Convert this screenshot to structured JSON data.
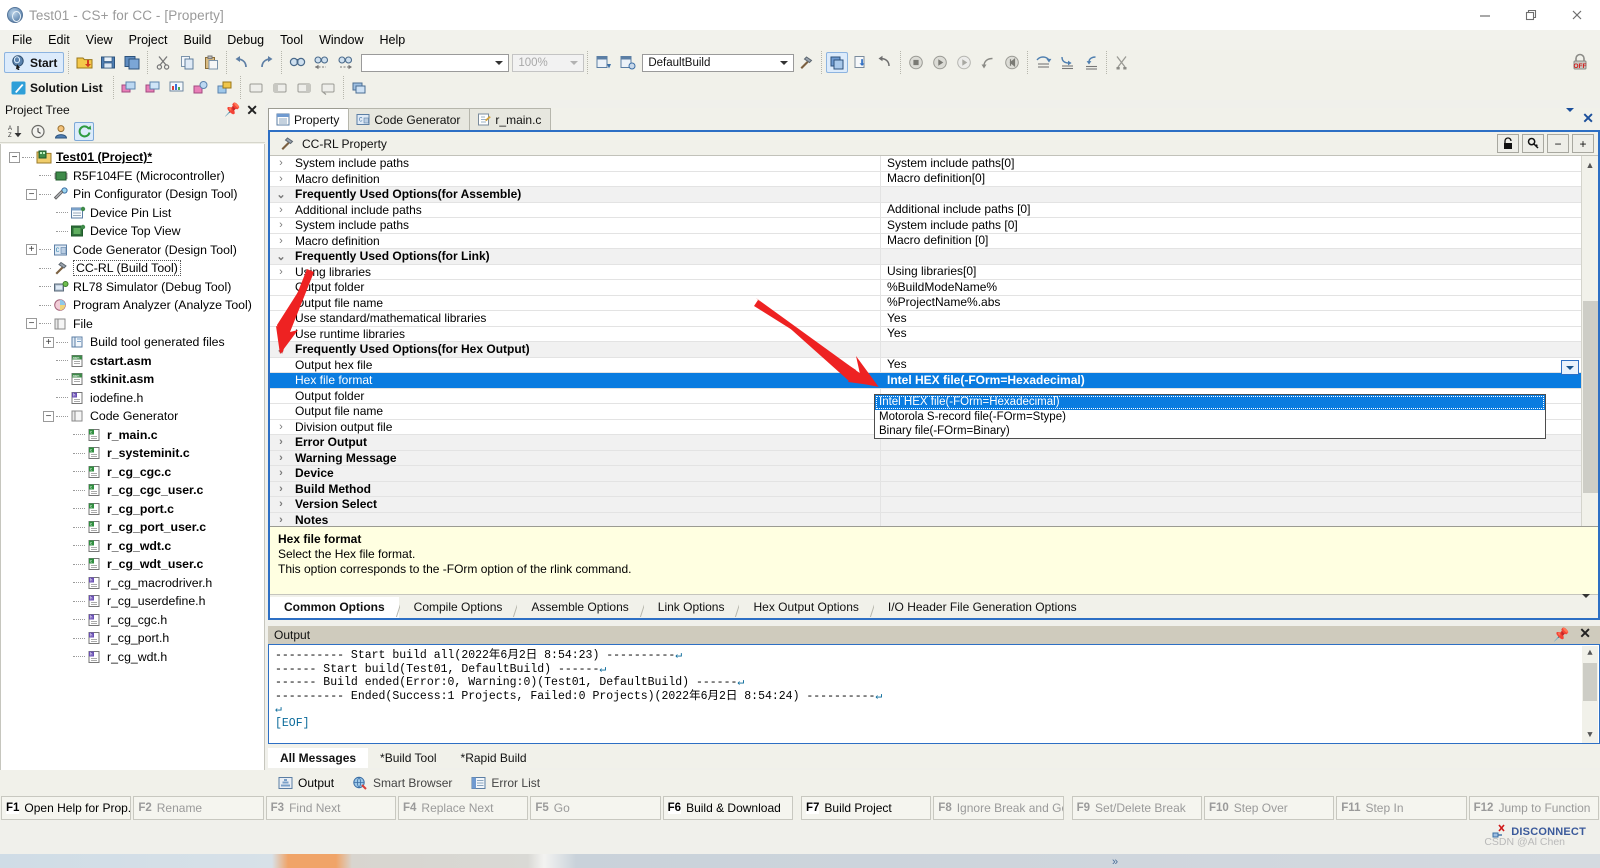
{
  "window": {
    "title": "Test01 - CS+ for CC - [Property]",
    "app_icon": "cs-plus-icon",
    "buttons": {
      "minimize": "minimize-icon",
      "restore": "restore-icon",
      "close": "close-icon"
    }
  },
  "menubar": {
    "items": [
      "File",
      "Edit",
      "View",
      "Project",
      "Build",
      "Debug",
      "Tool",
      "Window",
      "Help"
    ]
  },
  "toolbar1": {
    "start_label": "Start",
    "zoom_value": "100%",
    "search_value": "",
    "build_mode": "DefaultBuild",
    "icons": [
      "start-icon",
      "open-project-icon",
      "save-icon",
      "save-all-icon",
      "cut-icon",
      "copy-icon",
      "paste-icon",
      "undo-icon",
      "redo-icon",
      "find-icon",
      "find-previous-icon",
      "find-next-icon",
      "build-mode-icon",
      "build-mode-settings-icon",
      "build-tool-icon",
      "build-project-icon",
      "download-icon",
      "restart-icon",
      "stop-icon",
      "go-icon",
      "ignore-break-and-go-icon",
      "step-out-icon",
      "rewind-icon",
      "step-over-icon",
      "step-into-icon",
      "step-return-icon",
      "cpu-reset-icon"
    ]
  },
  "toolbar2": {
    "solution_list_label": "Solution List",
    "icons": [
      "solution-list-icon",
      "add-item-icon",
      "remove-item-icon",
      "chart-icon",
      "analyze-icon",
      "pin-icon",
      "window-icon",
      "dock-left-icon",
      "dock-right-icon",
      "float-icon",
      "cascade-icon"
    ]
  },
  "lock_indicator": "lock-off-icon",
  "project_tree": {
    "caption": "Project Tree",
    "toolbar_icons": [
      "sort-az-icon",
      "clock-icon",
      "user-icon",
      "refresh-icon"
    ],
    "nodes": [
      {
        "depth": 0,
        "label": "Test01 (Project)*",
        "icon": "project-icon",
        "expander": "-",
        "bold": true,
        "underline": true
      },
      {
        "depth": 1,
        "label": "R5F104FE (Microcontroller)",
        "icon": "microcontroller-icon",
        "expander": ""
      },
      {
        "depth": 1,
        "label": "Pin Configurator (Design Tool)",
        "icon": "pin-configurator-icon",
        "expander": "-"
      },
      {
        "depth": 2,
        "label": "Device Pin List",
        "icon": "device-pin-list-icon",
        "expander": ""
      },
      {
        "depth": 2,
        "label": "Device Top View",
        "icon": "device-top-view-icon",
        "expander": ""
      },
      {
        "depth": 1,
        "label": "Code Generator (Design Tool)",
        "icon": "code-generator-icon",
        "expander": "+"
      },
      {
        "depth": 1,
        "label": "CC-RL (Build Tool)",
        "icon": "build-tool-icon",
        "expander": "",
        "selected": true
      },
      {
        "depth": 1,
        "label": "RL78 Simulator (Debug Tool)",
        "icon": "simulator-icon",
        "expander": ""
      },
      {
        "depth": 1,
        "label": "Program Analyzer (Analyze Tool)",
        "icon": "analyzer-icon",
        "expander": ""
      },
      {
        "depth": 1,
        "label": "File",
        "icon": "folder-icon",
        "expander": "-"
      },
      {
        "depth": 2,
        "label": "Build tool generated files",
        "icon": "generated-files-icon",
        "expander": "+"
      },
      {
        "depth": 2,
        "label": "cstart.asm",
        "icon": "asm-file-icon",
        "expander": "",
        "bold": true
      },
      {
        "depth": 2,
        "label": "stkinit.asm",
        "icon": "asm-file-icon",
        "expander": "",
        "bold": true
      },
      {
        "depth": 2,
        "label": "iodefine.h",
        "icon": "h-file-icon",
        "expander": ""
      },
      {
        "depth": 2,
        "label": "Code Generator",
        "icon": "folder-icon",
        "expander": "-"
      },
      {
        "depth": 3,
        "label": "r_main.c",
        "icon": "c-file-icon",
        "expander": "",
        "bold": true
      },
      {
        "depth": 3,
        "label": "r_systeminit.c",
        "icon": "c-file-icon",
        "expander": "",
        "bold": true
      },
      {
        "depth": 3,
        "label": "r_cg_cgc.c",
        "icon": "c-file-icon",
        "expander": "",
        "bold": true
      },
      {
        "depth": 3,
        "label": "r_cg_cgc_user.c",
        "icon": "c-file-icon",
        "expander": "",
        "bold": true
      },
      {
        "depth": 3,
        "label": "r_cg_port.c",
        "icon": "c-file-icon",
        "expander": "",
        "bold": true
      },
      {
        "depth": 3,
        "label": "r_cg_port_user.c",
        "icon": "c-file-icon",
        "expander": "",
        "bold": true
      },
      {
        "depth": 3,
        "label": "r_cg_wdt.c",
        "icon": "c-file-icon",
        "expander": "",
        "bold": true
      },
      {
        "depth": 3,
        "label": "r_cg_wdt_user.c",
        "icon": "c-file-icon",
        "expander": "",
        "bold": true
      },
      {
        "depth": 3,
        "label": "r_cg_macrodriver.h",
        "icon": "h-file-icon",
        "expander": ""
      },
      {
        "depth": 3,
        "label": "r_cg_userdefine.h",
        "icon": "h-file-icon",
        "expander": ""
      },
      {
        "depth": 3,
        "label": "r_cg_cgc.h",
        "icon": "h-file-icon",
        "expander": ""
      },
      {
        "depth": 3,
        "label": "r_cg_port.h",
        "icon": "h-file-icon",
        "expander": ""
      },
      {
        "depth": 3,
        "label": "r_cg_wdt.h",
        "icon": "h-file-icon",
        "expander": ""
      }
    ]
  },
  "document_tabs": [
    {
      "label": "Property",
      "icon": "property-icon",
      "active": true
    },
    {
      "label": "Code Generator",
      "icon": "code-generator-icon",
      "active": false
    },
    {
      "label": "r_main.c",
      "icon": "c-file-icon",
      "active": false
    }
  ],
  "property": {
    "header_title": "CC-RL Property",
    "header_icon": "build-tool-icon",
    "header_buttons": [
      "lock-icon",
      "key-icon",
      "collapse-all-icon",
      "expand-all-icon"
    ],
    "rows": [
      {
        "exp": ">",
        "name": "System include paths",
        "value": "System include paths[0]",
        "kind": "normal"
      },
      {
        "exp": ">",
        "name": "Macro definition",
        "value": "Macro definition[0]",
        "kind": "normal"
      },
      {
        "exp": "v",
        "name": "Frequently Used Options(for Assemble)",
        "value": "",
        "kind": "group"
      },
      {
        "exp": ">",
        "name": "Additional include paths",
        "value": "Additional include paths [0]",
        "kind": "normal"
      },
      {
        "exp": ">",
        "name": "System include paths",
        "value": "System include paths [0]",
        "kind": "normal"
      },
      {
        "exp": ">",
        "name": "Macro definition",
        "value": "Macro definition [0]",
        "kind": "normal"
      },
      {
        "exp": "v",
        "name": "Frequently Used Options(for Link)",
        "value": "",
        "kind": "group"
      },
      {
        "exp": ">",
        "name": "Using libraries",
        "value": "Using libraries[0]",
        "kind": "normal"
      },
      {
        "exp": "",
        "name": "Output folder",
        "value": "%BuildModeName%",
        "kind": "normal"
      },
      {
        "exp": "",
        "name": "Output file name",
        "value": "%ProjectName%.abs",
        "kind": "normal"
      },
      {
        "exp": "",
        "name": "Use standard/mathematical libraries",
        "value": "Yes",
        "kind": "normal"
      },
      {
        "exp": "",
        "name": "Use runtime libraries",
        "value": "Yes",
        "kind": "normal"
      },
      {
        "exp": "v",
        "name": "Frequently Used Options(for Hex Output)",
        "value": "",
        "kind": "group"
      },
      {
        "exp": "",
        "name": "Output hex file",
        "value": "Yes",
        "kind": "normal"
      },
      {
        "exp": "",
        "name": "Hex file format",
        "value": "Intel HEX file(-FOrm=Hexadecimal)",
        "kind": "selected"
      },
      {
        "exp": "",
        "name": "Output folder",
        "value": "",
        "kind": "normal"
      },
      {
        "exp": "",
        "name": "Output file name",
        "value": "",
        "kind": "normal"
      },
      {
        "exp": ">",
        "name": "Division output file",
        "value": "",
        "kind": "normal"
      },
      {
        "exp": ">",
        "name": "Error Output",
        "value": "",
        "kind": "group"
      },
      {
        "exp": ">",
        "name": "Warning Message",
        "value": "",
        "kind": "group"
      },
      {
        "exp": ">",
        "name": "Device",
        "value": "",
        "kind": "group"
      },
      {
        "exp": ">",
        "name": "Build Method",
        "value": "",
        "kind": "group"
      },
      {
        "exp": ">",
        "name": "Version Select",
        "value": "",
        "kind": "group"
      },
      {
        "exp": ">",
        "name": "Notes",
        "value": "",
        "kind": "group"
      }
    ],
    "dropdown": {
      "open": true,
      "selected_index": 0,
      "options": [
        "Intel HEX file(-FOrm=Hexadecimal)",
        "Motorola S-record file(-FOrm=Stype)",
        "Binary file(-FOrm=Binary)"
      ]
    },
    "description": {
      "title": "Hex file format",
      "line1": "Select the Hex file format.",
      "line2": "This option corresponds to the -FOrm option of the rlink command."
    },
    "option_tabs": [
      {
        "label": "Common Options",
        "active": true
      },
      {
        "label": "Compile Options",
        "active": false
      },
      {
        "label": "Assemble Options",
        "active": false
      },
      {
        "label": "Link Options",
        "active": false
      },
      {
        "label": "Hex Output Options",
        "active": false
      },
      {
        "label": "I/O Header File Generation Options",
        "active": false
      }
    ]
  },
  "output": {
    "caption": "Output",
    "lines": [
      "---------- Start build all(2022年6月2日  8:54:23) ----------",
      "------ Start build(Test01, DefaultBuild) ------",
      "------ Build ended(Error:0, Warning:0)(Test01, DefaultBuild) ------",
      "---------- Ended(Success:1 Projects, Failed:0 Projects)(2022年6月2日  8:54:24) ----------",
      "",
      "[EOF]"
    ],
    "tabs": [
      {
        "label": "All Messages",
        "active": true
      },
      {
        "label": "*Build Tool",
        "active": false
      },
      {
        "label": "*Rapid Build",
        "active": false
      }
    ]
  },
  "dockbar": {
    "items": [
      {
        "label": "Output",
        "icon": "output-icon",
        "active": true
      },
      {
        "label": "Smart Browser",
        "icon": "smart-browser-icon",
        "active": false
      },
      {
        "label": "Error List",
        "icon": "error-list-icon",
        "active": false
      }
    ]
  },
  "fkeys": [
    {
      "num": "F1",
      "label": "Open Help for Prop...",
      "enabled": true
    },
    {
      "num": "F2",
      "label": "Rename",
      "enabled": false
    },
    {
      "num": "F3",
      "label": "Find Next",
      "enabled": false
    },
    {
      "num": "F4",
      "label": "Replace Next",
      "enabled": false
    },
    {
      "num": "F5",
      "label": "Go",
      "enabled": false
    },
    {
      "num": "F6",
      "label": "Build & Download",
      "enabled": true
    },
    {
      "num": "F7",
      "label": "Build Project",
      "enabled": true
    },
    {
      "num": "F8",
      "label": "Ignore Break and Go",
      "enabled": false
    },
    {
      "num": "F9",
      "label": "Set/Delete Break",
      "enabled": false
    },
    {
      "num": "F10",
      "label": "Step Over",
      "enabled": false
    },
    {
      "num": "F11",
      "label": "Step In",
      "enabled": false
    },
    {
      "num": "F12",
      "label": "Jump to Function",
      "enabled": false
    }
  ],
  "status": {
    "disconnect_label": "DISCONNECT",
    "watermark": "CSDN @Al Chen"
  },
  "colors": {
    "selection_blue": "#0a7ce0",
    "window_border_blue": "#2d6fc4",
    "annotation_red": "#ee2222",
    "description_bg": "#ffffe1",
    "toolbar_bg": "#f1f1ea"
  }
}
